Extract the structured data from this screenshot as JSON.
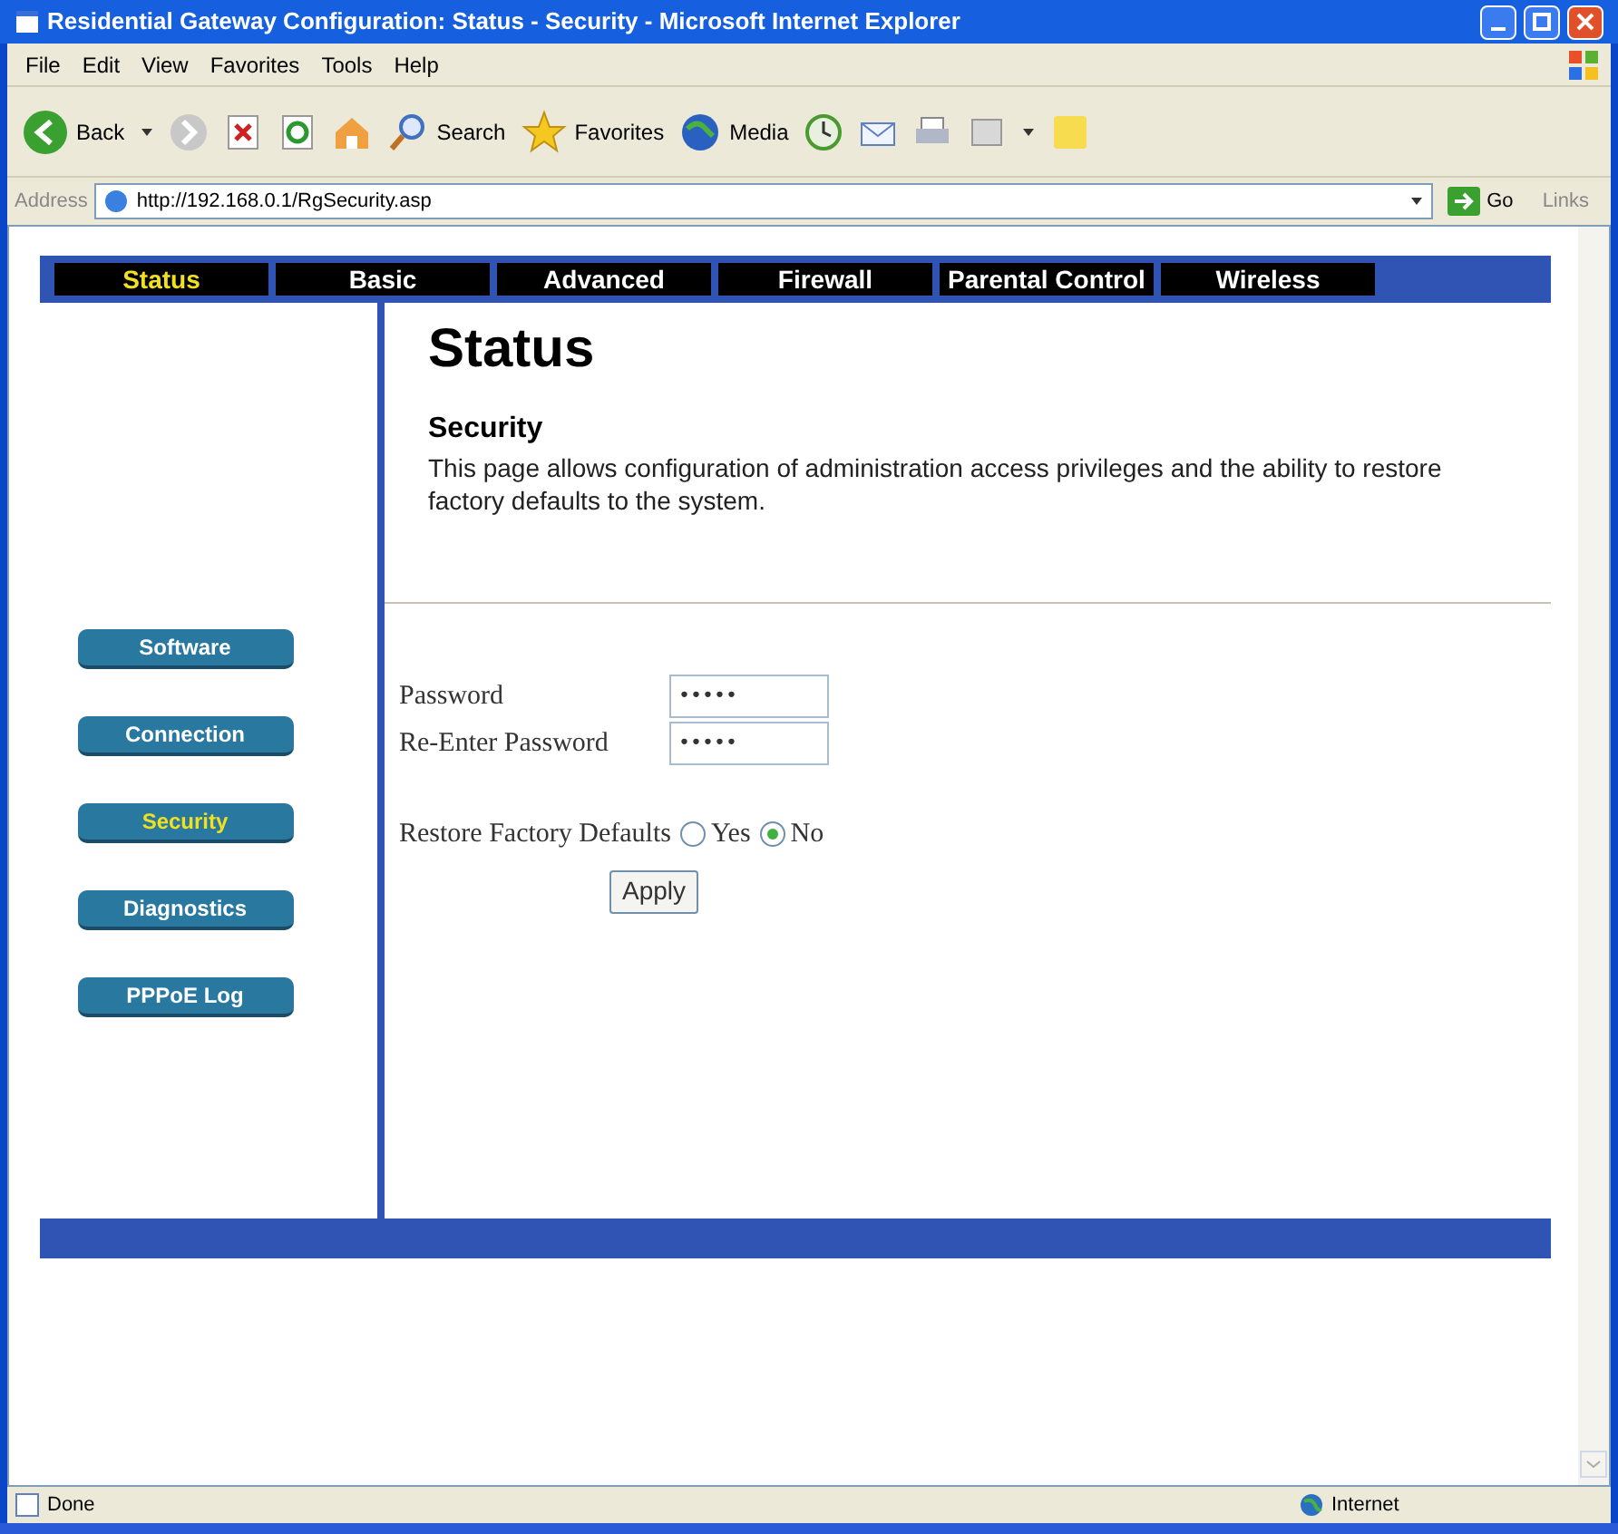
{
  "window": {
    "title": "Residential Gateway Configuration: Status - Security - Microsoft Internet Explorer"
  },
  "menu": [
    "File",
    "Edit",
    "View",
    "Favorites",
    "Tools",
    "Help"
  ],
  "toolbar": {
    "back": "Back",
    "search": "Search",
    "favorites": "Favorites",
    "media": "Media"
  },
  "address_bar": {
    "label": "Address",
    "url": "http://192.168.0.1/RgSecurity.asp",
    "go": "Go",
    "links": "Links"
  },
  "nav_tabs": [
    {
      "label": "Status",
      "selected": true
    },
    {
      "label": "Basic",
      "selected": false
    },
    {
      "label": "Advanced",
      "selected": false
    },
    {
      "label": "Firewall",
      "selected": false
    },
    {
      "label": "Parental Control",
      "selected": false
    },
    {
      "label": "Wireless",
      "selected": false
    }
  ],
  "side_menu": [
    {
      "label": "Software",
      "selected": false
    },
    {
      "label": "Connection",
      "selected": false
    },
    {
      "label": "Security",
      "selected": true
    },
    {
      "label": "Diagnostics",
      "selected": false
    },
    {
      "label": "PPPoE Log",
      "selected": false
    }
  ],
  "page": {
    "heading": "Status",
    "section": "Security",
    "description": "This page allows configuration of administration access privileges and the ability to restore factory defaults to the system."
  },
  "form": {
    "fields": [
      {
        "label": "Password",
        "value": "•••••"
      },
      {
        "label": "Re-Enter Password",
        "value": "•••••"
      }
    ],
    "restore": {
      "label": "Restore Factory Defaults",
      "options": [
        {
          "label": "Yes",
          "selected": false
        },
        {
          "label": "No",
          "selected": true
        }
      ]
    },
    "apply": "Apply"
  },
  "status_bar": {
    "text": "Done",
    "zone": "Internet"
  }
}
